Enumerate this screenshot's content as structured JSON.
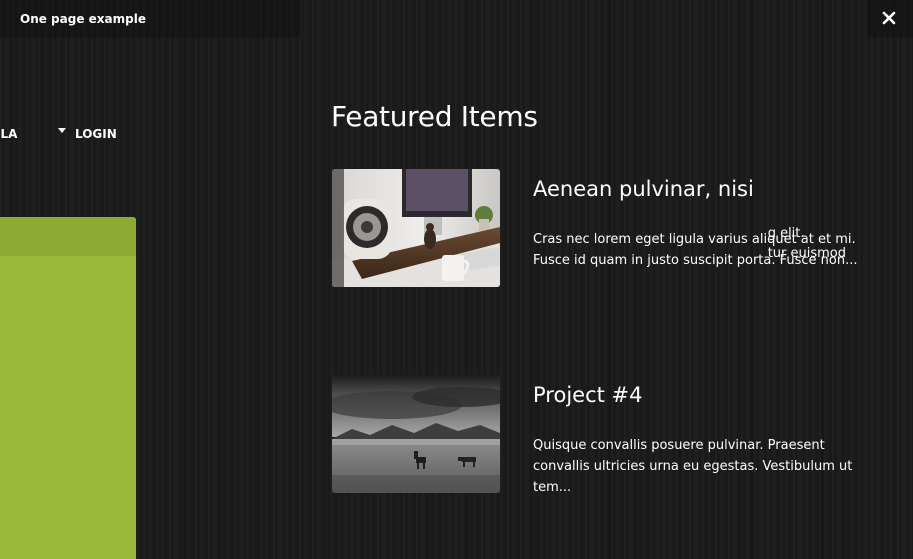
{
  "window": {
    "title": "One page example"
  },
  "nav": {
    "partial_item": "ILA",
    "login_label": "LOGIN"
  },
  "green_panel": {
    "line_1": "g elit.",
    "line_2": "tur euismod"
  },
  "featured": {
    "heading": "Featured Items",
    "items": [
      {
        "title": "Aenean pulvinar, nisi",
        "excerpt": "Cras nec lorem eget ligula varius aliquet at et mi. Fusce id quam in justo suscipit porta. Fusce non...",
        "image": "desk-speaker-photo"
      },
      {
        "title": "Project #4",
        "excerpt": " Quisque convallis posuere pulvinar. Praesent convallis ultricies urna eu egestas. Vestibulum ut tem...",
        "image": "horses-landscape-photo"
      }
    ]
  },
  "colors": {
    "background": "#1b1b1b",
    "accent_green": "#9ab93a",
    "accent_green_dark": "#8daa33",
    "text": "#ffffff"
  }
}
